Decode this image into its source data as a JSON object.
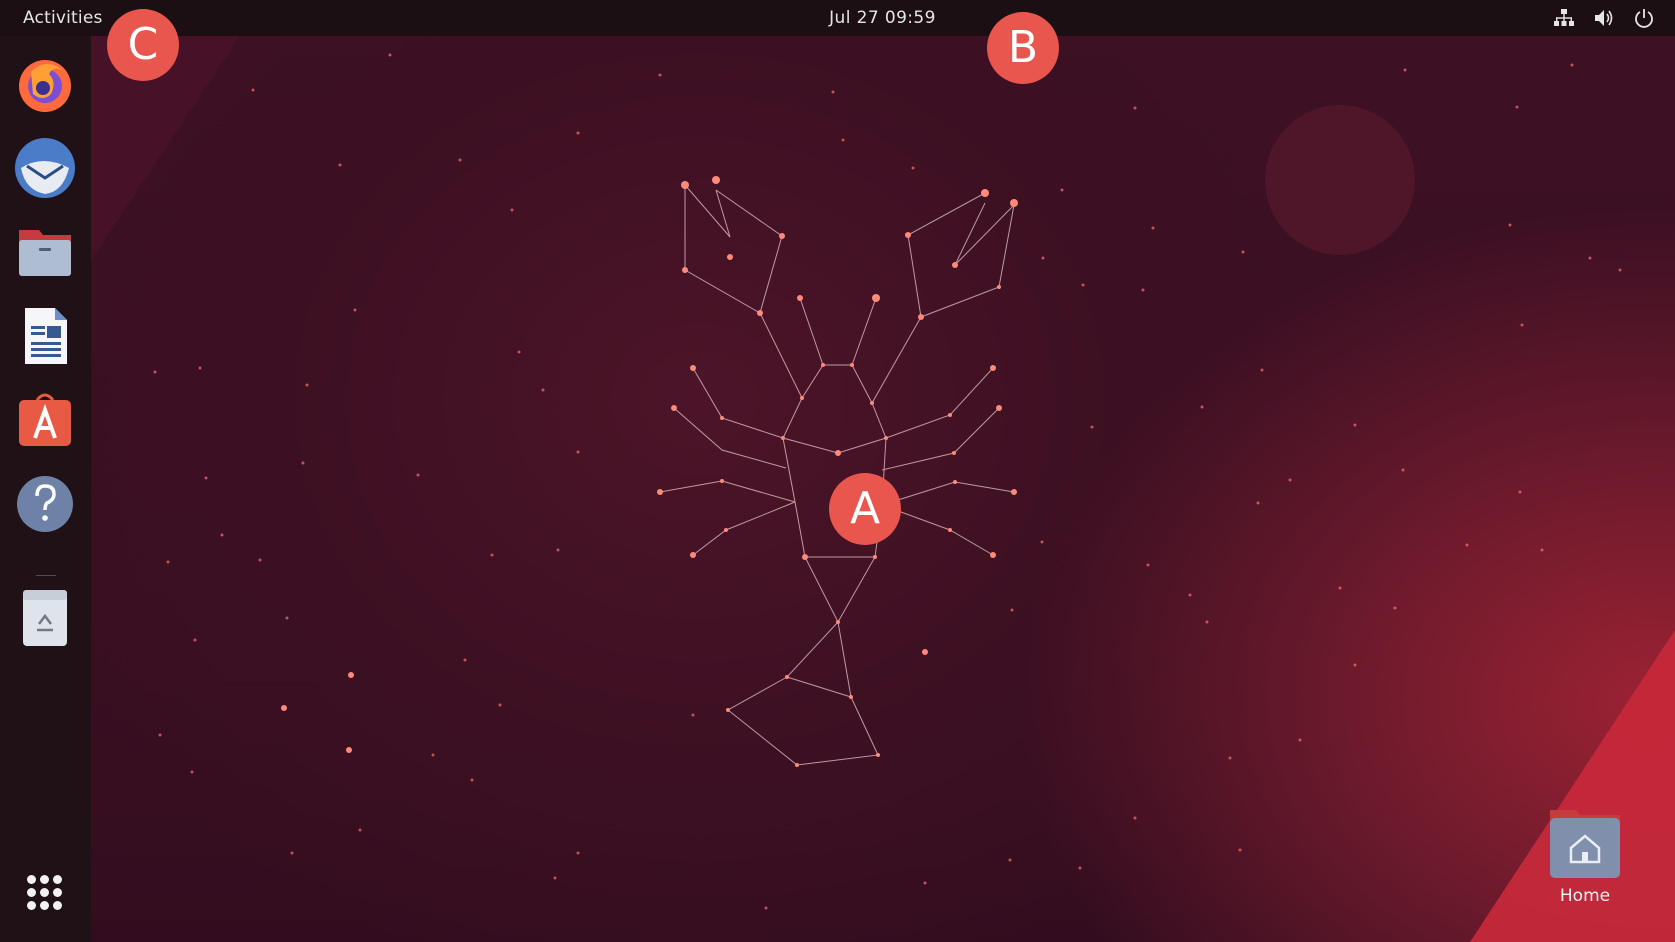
{
  "topbar": {
    "activities_label": "Activities",
    "clock": "Jul 27  09:59",
    "tray_icons": [
      "network-icon",
      "volume-icon",
      "power-icon"
    ]
  },
  "dock": {
    "items": [
      {
        "name": "firefox-icon"
      },
      {
        "name": "thunderbird-icon"
      },
      {
        "name": "files-icon"
      },
      {
        "name": "libreoffice-writer-icon"
      },
      {
        "name": "app-center-icon"
      },
      {
        "name": "help-icon"
      },
      {
        "name": "trash-icon"
      }
    ],
    "show_apps": "show-applications-icon"
  },
  "desktop": {
    "home_label": "Home"
  },
  "markers": {
    "a": "A",
    "b": "B",
    "c": "C"
  },
  "colors": {
    "topbar": "#1b0f14",
    "dock": "#201116",
    "accent": "#e9564e",
    "wallpaper": "#3a0f22"
  }
}
